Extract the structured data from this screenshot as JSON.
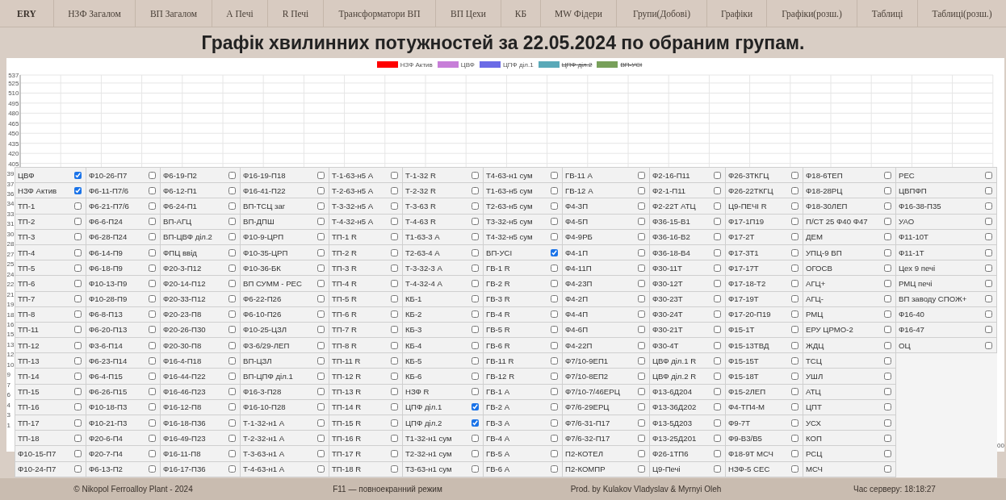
{
  "nav": [
    {
      "label": "ERY",
      "kind": "brand"
    },
    {
      "label": "НЗФ Загалом",
      "kind": "link"
    },
    {
      "label": "ВП Загалом",
      "kind": "link"
    },
    {
      "label": "А Печі",
      "kind": "link"
    },
    {
      "label": "R Печі",
      "kind": "link"
    },
    {
      "label": "Трансформатори ВП",
      "kind": "link"
    },
    {
      "label": "ВП Цехи",
      "kind": "link"
    },
    {
      "label": "КБ",
      "kind": "link"
    },
    {
      "label": "MW Фідери",
      "kind": "link"
    },
    {
      "label": "Групи(Добові)",
      "kind": "link"
    },
    {
      "label": "Графіки",
      "kind": "link"
    },
    {
      "label": "Графіки(розш.)",
      "kind": "link"
    },
    {
      "label": "Таблиці",
      "kind": "link"
    },
    {
      "label": "Таблиці(розш.)",
      "kind": "link"
    }
  ],
  "title": "Графік хвилинних потужностей за 22.05.2024 по обраним групам.",
  "chart": {
    "edge_label": "00",
    "legend": [
      {
        "hidden": false
      },
      {
        "hidden": false
      },
      {
        "hidden": false
      },
      {
        "hidden": true
      },
      {
        "hidden": true
      }
    ],
    "partial_tick_labels": [
      "39",
      "37",
      "36",
      "34",
      "33",
      "31",
      "30",
      "28",
      "27",
      "25",
      "24",
      "22",
      "21",
      "19",
      "18",
      "16",
      "15",
      "13",
      "12",
      "10",
      "9",
      "7",
      "6",
      "4",
      "3",
      "1"
    ],
    "chart_data": {
      "type": "line",
      "grid": true,
      "series": [
        {
          "name": "НЗФ Актив",
          "color": "#ff0000"
        },
        {
          "name": "ЦВФ",
          "color": "#c77ed8"
        },
        {
          "name": "ЦПФ діл.1",
          "color": "#6b6be6"
        },
        {
          "name": "ЦПФ діл.2",
          "color": "#5aa9b8"
        },
        {
          "name": "ВП-УСІ",
          "color": "#78a05a"
        }
      ],
      "ylim": [
        0,
        537
      ],
      "yticks": [
        537,
        525,
        510,
        495,
        480,
        465,
        450,
        435,
        420,
        405
      ]
    }
  },
  "groups": {
    "columns": [
      {
        "items": [
          {
            "label": "ЦВФ",
            "checked": true
          },
          {
            "label": "НЗФ Актив",
            "checked": true
          },
          {
            "label": "ТП-1",
            "checked": false
          },
          {
            "label": "ТП-2",
            "checked": false
          },
          {
            "label": "ТП-3",
            "checked": false
          },
          {
            "label": "ТП-4",
            "checked": false
          },
          {
            "label": "ТП-5",
            "checked": false
          },
          {
            "label": "ТП-6",
            "checked": false
          },
          {
            "label": "ТП-7",
            "checked": false
          },
          {
            "label": "ТП-8",
            "checked": false
          },
          {
            "label": "ТП-11",
            "checked": false
          },
          {
            "label": "ТП-12",
            "checked": false
          },
          {
            "label": "ТП-13",
            "checked": false
          },
          {
            "label": "ТП-14",
            "checked": false
          },
          {
            "label": "ТП-15",
            "checked": false
          },
          {
            "label": "ТП-16",
            "checked": false
          },
          {
            "label": "ТП-17",
            "checked": false
          },
          {
            "label": "ТП-18",
            "checked": false
          },
          {
            "label": "Ф10-15-П7",
            "checked": false
          },
          {
            "label": "Ф10-24-П7",
            "checked": false
          }
        ]
      },
      {
        "items": [
          {
            "label": "Ф10-26-П7",
            "checked": false
          },
          {
            "label": "Ф6-11-П7/6",
            "checked": false
          },
          {
            "label": "Ф6-21-П7/6",
            "checked": false
          },
          {
            "label": "Ф6-6-П24",
            "checked": false
          },
          {
            "label": "Ф6-28-П24",
            "checked": false
          },
          {
            "label": "Ф6-14-П9",
            "checked": false
          },
          {
            "label": "Ф6-18-П9",
            "checked": false
          },
          {
            "label": "Ф10-13-П9",
            "checked": false
          },
          {
            "label": "Ф10-28-П9",
            "checked": false
          },
          {
            "label": "Ф6-8-П13",
            "checked": false
          },
          {
            "label": "Ф6-20-П13",
            "checked": false
          },
          {
            "label": "Ф3-6-П14",
            "checked": false
          },
          {
            "label": "Ф6-23-П14",
            "checked": false
          },
          {
            "label": "Ф6-4-П15",
            "checked": false
          },
          {
            "label": "Ф6-26-П15",
            "checked": false
          },
          {
            "label": "Ф10-18-П3",
            "checked": false
          },
          {
            "label": "Ф10-21-П3",
            "checked": false
          },
          {
            "label": "Ф20-6-П4",
            "checked": false
          },
          {
            "label": "Ф20-7-П4",
            "checked": false
          },
          {
            "label": "Ф6-13-П2",
            "checked": false
          }
        ]
      },
      {
        "items": [
          {
            "label": "Ф6-19-П2",
            "checked": false
          },
          {
            "label": "Ф6-12-П1",
            "checked": false
          },
          {
            "label": "Ф6-24-П1",
            "checked": false
          },
          {
            "label": "ВП-АГЦ",
            "checked": false
          },
          {
            "label": "ВП-ЦВФ діл.2",
            "checked": false
          },
          {
            "label": "ФПЦ ввід",
            "checked": false
          },
          {
            "label": "Ф20-3-П12",
            "checked": false
          },
          {
            "label": "Ф20-14-П12",
            "checked": false
          },
          {
            "label": "Ф20-33-П12",
            "checked": false
          },
          {
            "label": "Ф20-23-П8",
            "checked": false
          },
          {
            "label": "Ф20-26-П30",
            "checked": false
          },
          {
            "label": "Ф20-30-П8",
            "checked": false
          },
          {
            "label": "Ф16-4-П18",
            "checked": false
          },
          {
            "label": "Ф16-44-П22",
            "checked": false
          },
          {
            "label": "Ф16-46-П23",
            "checked": false
          },
          {
            "label": "Ф16-12-П8",
            "checked": false
          },
          {
            "label": "Ф16-18-П36",
            "checked": false
          },
          {
            "label": "Ф16-49-П23",
            "checked": false
          },
          {
            "label": "Ф16-11-П8",
            "checked": false
          },
          {
            "label": "Ф16-17-П36",
            "checked": false
          }
        ]
      },
      {
        "items": [
          {
            "label": "Ф16-19-П18",
            "checked": false
          },
          {
            "label": "Ф16-41-П22",
            "checked": false
          },
          {
            "label": "ВП-ТСЦ заг",
            "checked": false
          },
          {
            "label": "ВП-ДПШ",
            "checked": false
          },
          {
            "label": "Ф10-9-ЦРП",
            "checked": false
          },
          {
            "label": "Ф10-35-ЦРП",
            "checked": false
          },
          {
            "label": "Ф10-36-БК",
            "checked": false
          },
          {
            "label": "ВП СУММ - РЕС",
            "checked": false
          },
          {
            "label": "Ф6-22-П26",
            "checked": false
          },
          {
            "label": "Ф6-10-П26",
            "checked": false
          },
          {
            "label": "Ф10-25-ЦЗЛ",
            "checked": false
          },
          {
            "label": "Ф3-6/29-ЛЕП",
            "checked": false
          },
          {
            "label": "ВП-ЦЗЛ",
            "checked": false
          },
          {
            "label": "ВП-ЦПФ діл.1",
            "checked": false
          },
          {
            "label": "Ф16-3-П28",
            "checked": false
          },
          {
            "label": "Ф16-10-П28",
            "checked": false
          },
          {
            "label": "Т-1-32-н1 А",
            "checked": false
          },
          {
            "label": "Т-2-32-н1 А",
            "checked": false
          },
          {
            "label": "Т-3-63-н1 А",
            "checked": false
          },
          {
            "label": "Т-4-63-н1 А",
            "checked": false
          }
        ]
      },
      {
        "items": [
          {
            "label": "Т-1-63-н5 А",
            "checked": false
          },
          {
            "label": "Т-2-63-н5 А",
            "checked": false
          },
          {
            "label": "Т-3-32-н5 А",
            "checked": false
          },
          {
            "label": "Т-4-32-н5 А",
            "checked": false
          },
          {
            "label": "ТП-1 R",
            "checked": false
          },
          {
            "label": "ТП-2 R",
            "checked": false
          },
          {
            "label": "ТП-3 R",
            "checked": false
          },
          {
            "label": "ТП-4 R",
            "checked": false
          },
          {
            "label": "ТП-5 R",
            "checked": false
          },
          {
            "label": "ТП-6 R",
            "checked": false
          },
          {
            "label": "ТП-7 R",
            "checked": false
          },
          {
            "label": "ТП-8 R",
            "checked": false
          },
          {
            "label": "ТП-11 R",
            "checked": false
          },
          {
            "label": "ТП-12 R",
            "checked": false
          },
          {
            "label": "ТП-13 R",
            "checked": false
          },
          {
            "label": "ТП-14 R",
            "checked": false
          },
          {
            "label": "ТП-15 R",
            "checked": false
          },
          {
            "label": "ТП-16 R",
            "checked": false
          },
          {
            "label": "ТП-17 R",
            "checked": false
          },
          {
            "label": "ТП-18 R",
            "checked": false
          }
        ]
      },
      {
        "items": [
          {
            "label": "Т-1-32 R",
            "checked": false
          },
          {
            "label": "Т-2-32 R",
            "checked": false
          },
          {
            "label": "Т-3-63 R",
            "checked": false
          },
          {
            "label": "Т-4-63 R",
            "checked": false
          },
          {
            "label": "Т1-63-3 А",
            "checked": false
          },
          {
            "label": "Т2-63-4 А",
            "checked": false
          },
          {
            "label": "Т-3-32-3 А",
            "checked": false
          },
          {
            "label": "Т-4-32-4 А",
            "checked": false
          },
          {
            "label": "КБ-1",
            "checked": false
          },
          {
            "label": "КБ-2",
            "checked": false
          },
          {
            "label": "КБ-3",
            "checked": false
          },
          {
            "label": "КБ-4",
            "checked": false
          },
          {
            "label": "КБ-5",
            "checked": false
          },
          {
            "label": "КБ-6",
            "checked": false
          },
          {
            "label": "НЗФ R",
            "checked": false
          },
          {
            "label": "ЦПФ діл.1",
            "checked": true
          },
          {
            "label": "ЦПФ діл.2",
            "checked": true
          },
          {
            "label": "Т1-32-н1 сум",
            "checked": false
          },
          {
            "label": "Т2-32-н1 сум",
            "checked": false
          },
          {
            "label": "Т3-63-н1 сум",
            "checked": false
          }
        ]
      },
      {
        "items": [
          {
            "label": "Т4-63-н1 сум",
            "checked": false
          },
          {
            "label": "Т1-63-н5 сум",
            "checked": false
          },
          {
            "label": "Т2-63-н5 сум",
            "checked": false
          },
          {
            "label": "Т3-32-н5 сум",
            "checked": false
          },
          {
            "label": "Т4-32-н5 сум",
            "checked": false
          },
          {
            "label": "ВП-УСІ",
            "checked": true
          },
          {
            "label": "ГВ-1 R",
            "checked": false
          },
          {
            "label": "ГВ-2 R",
            "checked": false
          },
          {
            "label": "ГВ-3 R",
            "checked": false
          },
          {
            "label": "ГВ-4 R",
            "checked": false
          },
          {
            "label": "ГВ-5 R",
            "checked": false
          },
          {
            "label": "ГВ-6 R",
            "checked": false
          },
          {
            "label": "ГВ-11 R",
            "checked": false
          },
          {
            "label": "ГВ-12 R",
            "checked": false
          },
          {
            "label": "ГВ-1 А",
            "checked": false
          },
          {
            "label": "ГВ-2 А",
            "checked": false
          },
          {
            "label": "ГВ-3 А",
            "checked": false
          },
          {
            "label": "ГВ-4 А",
            "checked": false
          },
          {
            "label": "ГВ-5 А",
            "checked": false
          },
          {
            "label": "ГВ-6 А",
            "checked": false
          }
        ]
      },
      {
        "items": [
          {
            "label": "ГВ-11 А",
            "checked": false
          },
          {
            "label": "ГВ-12 А",
            "checked": false
          },
          {
            "label": "Ф4-3П",
            "checked": false
          },
          {
            "label": "Ф4-5П",
            "checked": false
          },
          {
            "label": "Ф4-9РБ",
            "checked": false
          },
          {
            "label": "Ф4-1П",
            "checked": false
          },
          {
            "label": "Ф4-11П",
            "checked": false
          },
          {
            "label": "Ф4-23П",
            "checked": false
          },
          {
            "label": "Ф4-2П",
            "checked": false
          },
          {
            "label": "Ф4-4П",
            "checked": false
          },
          {
            "label": "Ф4-6П",
            "checked": false
          },
          {
            "label": "Ф4-22П",
            "checked": false
          },
          {
            "label": "Ф7/10-9ЕП1",
            "checked": false
          },
          {
            "label": "Ф7/10-8ЕП2",
            "checked": false
          },
          {
            "label": "Ф7/10-7/46ЕРЦ",
            "checked": false
          },
          {
            "label": "Ф7/6-29ЕРЦ",
            "checked": false
          },
          {
            "label": "Ф7/6-31-П17",
            "checked": false
          },
          {
            "label": "Ф7/6-32-П17",
            "checked": false
          },
          {
            "label": "П2-КОТЕЛ",
            "checked": false
          },
          {
            "label": "П2-КОМПР",
            "checked": false
          }
        ]
      },
      {
        "items": [
          {
            "label": "Ф2-16-П11",
            "checked": false
          },
          {
            "label": "Ф2-1-П11",
            "checked": false
          },
          {
            "label": "Ф2-22Т АТЦ",
            "checked": false
          },
          {
            "label": "Ф36-15-В1",
            "checked": false
          },
          {
            "label": "Ф36-16-В2",
            "checked": false
          },
          {
            "label": "Ф36-18-В4",
            "checked": false
          },
          {
            "label": "Ф30-11Т",
            "checked": false
          },
          {
            "label": "Ф30-12Т",
            "checked": false
          },
          {
            "label": "Ф30-23Т",
            "checked": false
          },
          {
            "label": "Ф30-24Т",
            "checked": false
          },
          {
            "label": "Ф30-21Т",
            "checked": false
          },
          {
            "label": "Ф30-4Т",
            "checked": false
          },
          {
            "label": "ЦВФ діл.1 R",
            "checked": false
          },
          {
            "label": "ЦВФ діл.2 R",
            "checked": false
          },
          {
            "label": "Ф13-6Д204",
            "checked": false
          },
          {
            "label": "Ф13-36Д202",
            "checked": false
          },
          {
            "label": "Ф13-5Д203",
            "checked": false
          },
          {
            "label": "Ф13-25Д201",
            "checked": false
          },
          {
            "label": "Ф26-1ТП6",
            "checked": false
          },
          {
            "label": "Ц9-Печі",
            "checked": false
          }
        ]
      },
      {
        "items": [
          {
            "label": "Ф26-3ТКГЦ",
            "checked": false
          },
          {
            "label": "Ф26-22ТКГЦ",
            "checked": false
          },
          {
            "label": "Ц9-ПЕЧІ R",
            "checked": false
          },
          {
            "label": "Ф17-1П19",
            "checked": false
          },
          {
            "label": "Ф17-2Т",
            "checked": false
          },
          {
            "label": "Ф17-3Т1",
            "checked": false
          },
          {
            "label": "Ф17-17Т",
            "checked": false
          },
          {
            "label": "Ф17-18-Т2",
            "checked": false
          },
          {
            "label": "Ф17-19Т",
            "checked": false
          },
          {
            "label": "Ф17-20-П19",
            "checked": false
          },
          {
            "label": "Ф15-1Т",
            "checked": false
          },
          {
            "label": "Ф15-13ТВД",
            "checked": false
          },
          {
            "label": "Ф15-15Т",
            "checked": false
          },
          {
            "label": "Ф15-18Т",
            "checked": false
          },
          {
            "label": "Ф15-2ЛЕП",
            "checked": false
          },
          {
            "label": "Ф4-ТП4-М",
            "checked": false
          },
          {
            "label": "Ф9-7Т",
            "checked": false
          },
          {
            "label": "Ф9-В3/В5",
            "checked": false
          },
          {
            "label": "Ф18-9Т МСЧ",
            "checked": false
          },
          {
            "label": "НЗФ-5 СЕС",
            "checked": false
          }
        ]
      },
      {
        "items": [
          {
            "label": "Ф18-6ТЕП",
            "checked": false
          },
          {
            "label": "Ф18-28РЦ",
            "checked": false
          },
          {
            "label": "Ф18-30ЛЕП",
            "checked": false
          },
          {
            "label": "П/СТ 25 Ф40 Ф47",
            "checked": false
          },
          {
            "label": "ДЕМ",
            "checked": false
          },
          {
            "label": "УПЦ-9 ВП",
            "checked": false
          },
          {
            "label": "ОГОСВ",
            "checked": false
          },
          {
            "label": "АГЦ+",
            "checked": false
          },
          {
            "label": "АГЦ-",
            "checked": false
          },
          {
            "label": "РМЦ",
            "checked": false
          },
          {
            "label": "ЕРУ ЦРМО-2",
            "checked": false
          },
          {
            "label": "ЖДЦ",
            "checked": false
          },
          {
            "label": "ТСЦ",
            "checked": false
          },
          {
            "label": "УШЛ",
            "checked": false
          },
          {
            "label": "АТЦ",
            "checked": false
          },
          {
            "label": "ЦПТ",
            "checked": false
          },
          {
            "label": "УСХ",
            "checked": false
          },
          {
            "label": "КОП",
            "checked": false
          },
          {
            "label": "РСЦ",
            "checked": false
          },
          {
            "label": "МСЧ",
            "checked": false
          }
        ]
      },
      {
        "items": [
          {
            "label": "РЕС",
            "checked": false
          },
          {
            "label": "ЦВПФП",
            "checked": false
          },
          {
            "label": "Ф16-38-П35",
            "checked": false
          },
          {
            "label": "УАО",
            "checked": false
          },
          {
            "label": "Ф11-10Т",
            "checked": false
          },
          {
            "label": "Ф11-1Т",
            "checked": false
          },
          {
            "label": "Цех 9 печі",
            "checked": false
          },
          {
            "label": "РМЦ печі",
            "checked": false
          },
          {
            "label": "ВП заводу СПОЖ+",
            "checked": false
          },
          {
            "label": "Ф16-40",
            "checked": false
          },
          {
            "label": "Ф16-47",
            "checked": false
          },
          {
            "label": "ОЦ",
            "checked": false
          }
        ]
      }
    ]
  },
  "footer": {
    "copyright": "© Nikopol Ferroalloy Plant - 2024",
    "hint": "F11 — повноекранний режим",
    "credits": "Prod. by Kulakov Vladyslav & Myrnyi Oleh",
    "server_time": "Час серверу: 18:18:27"
  }
}
